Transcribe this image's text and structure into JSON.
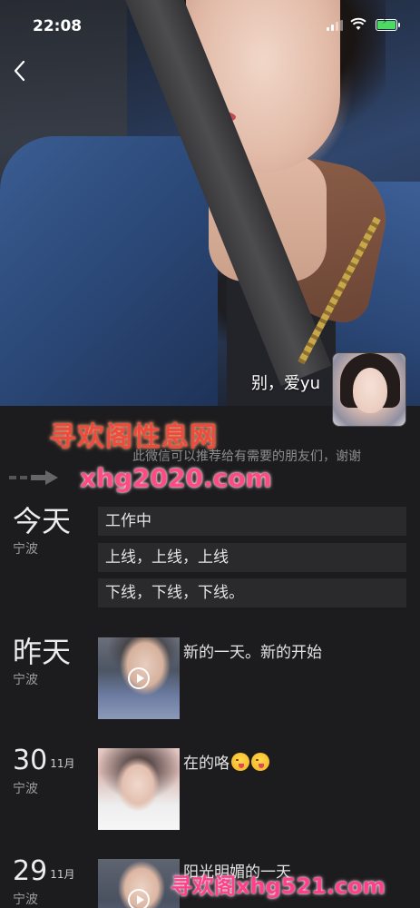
{
  "status_bar": {
    "time": "22:08"
  },
  "header": {
    "back_icon": "chevron-left-icon"
  },
  "profile": {
    "name": "别，爱yu"
  },
  "signature": "此微信可以推荐给有需要的朋友们，谢谢",
  "watermarks": {
    "top": "寻欢阁性息网",
    "middle": "xhg2020.com",
    "bottom": "寻欢阁xhg521.com"
  },
  "timeline": [
    {
      "label": "今天",
      "location": "宁波",
      "posts": [
        "工作中",
        "上线，上线，上线",
        "下线，下线，下线。"
      ]
    },
    {
      "label": "昨天",
      "location": "宁波",
      "caption": "新的一天。新的开始",
      "video": true
    },
    {
      "day": "30",
      "month": "11月",
      "location": "宁波",
      "caption": "在的咯"
    },
    {
      "day": "29",
      "month": "11月",
      "location": "宁波",
      "caption": "阳光明媚的一天",
      "video": true
    }
  ]
}
